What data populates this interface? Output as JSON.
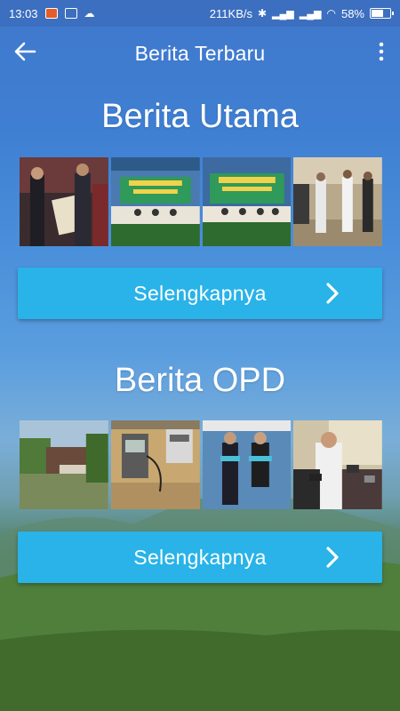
{
  "status_bar": {
    "time": "13:03",
    "net_speed": "211KB/s",
    "battery": "58%"
  },
  "app_bar": {
    "title": "Berita Terbaru",
    "back_icon": "arrow-left-icon",
    "menu_icon": "more-vertical-icon"
  },
  "sections": [
    {
      "title": "Berita Utama",
      "button_label": "Selengkapnya",
      "thumbs": [
        "award-ceremony",
        "meeting-banner",
        "meeting-stage",
        "signing-ceremony"
      ]
    },
    {
      "title": "Berita OPD",
      "button_label": "Selengkapnya",
      "thumbs": [
        "office-building",
        "electric-meter",
        "couple-portrait",
        "press-interview"
      ]
    }
  ],
  "colors": {
    "button": "#29b3e8",
    "sky": "#3f78cc"
  }
}
